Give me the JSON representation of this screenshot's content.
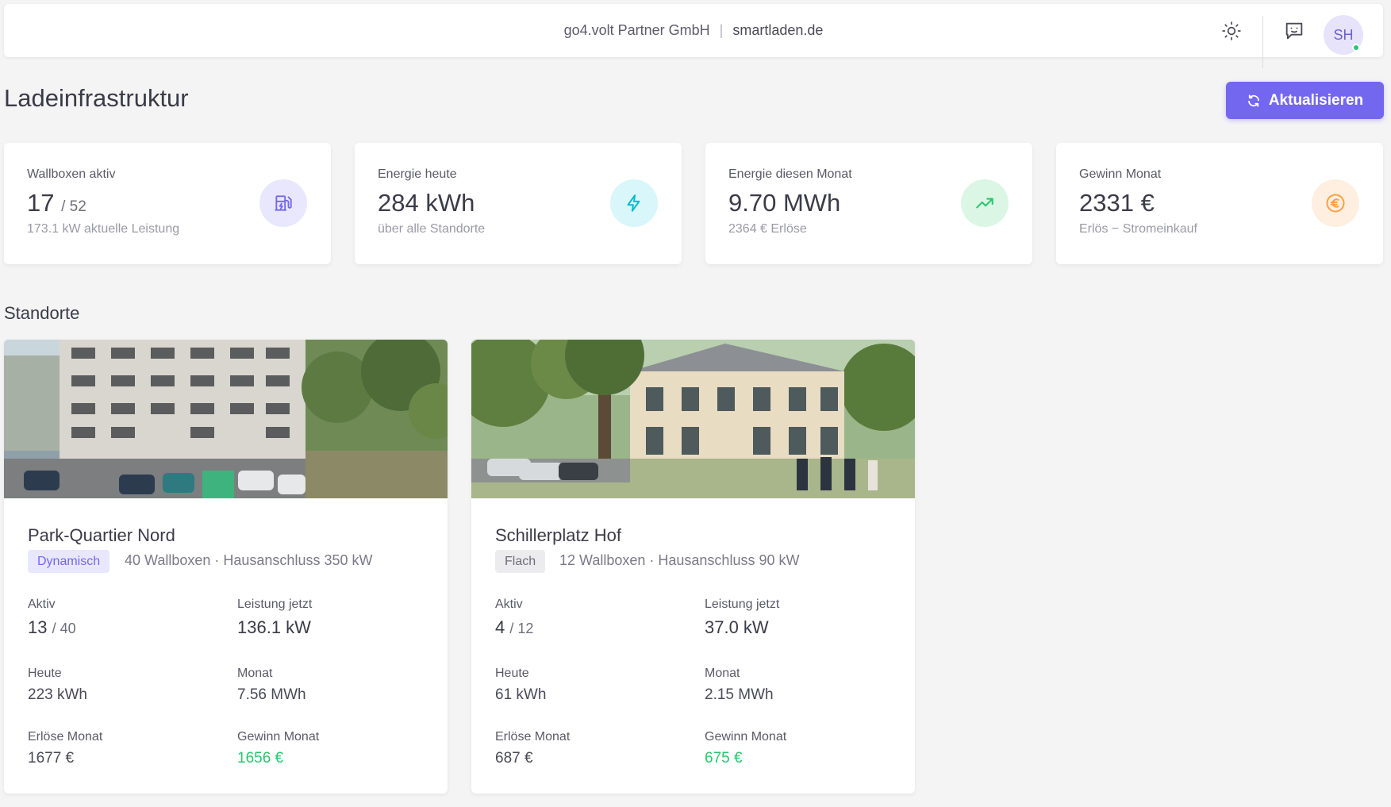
{
  "header": {
    "company": "go4.volt Partner GmbH",
    "separator": "|",
    "site": "smartladen.de",
    "theme_icon": "sun-icon",
    "chat_icon": "chat-icon",
    "avatar_initials": "SH",
    "avatar_status_color": "#28c76f"
  },
  "page": {
    "title": "Ladeinfrastruktur",
    "refresh_label": "Aktualisieren",
    "refresh_icon": "refresh-icon",
    "accent": "#7367f0"
  },
  "kpis": [
    {
      "label": "Wallboxen aktiv",
      "value": "17",
      "value_sub": "/ 52",
      "desc": "173.1 kW aktuelle Leistung",
      "icon": "ev-station-icon",
      "color": "#7367f0"
    },
    {
      "label": "Energie heute",
      "value": "284 kWh",
      "value_sub": "",
      "desc": "über alle Standorte",
      "icon": "lightning-icon",
      "color": "#00bad1"
    },
    {
      "label": "Energie diesen Monat",
      "value": "9.70 MWh",
      "value_sub": "",
      "desc": "2364 € Erlöse",
      "icon": "trending-up-icon",
      "color": "#28c76f"
    },
    {
      "label": "Gewinn Monat",
      "value": "2331 €",
      "value_sub": "",
      "desc": "Erlös − Stromeinkauf",
      "icon": "euro-icon",
      "color": "#ff9f43"
    }
  ],
  "section_title": "Standorte",
  "locations": [
    {
      "name": "Park-Quartier Nord",
      "tag": "Dynamisch",
      "meta": "40 Wallboxen · Hausanschluss 350 kW",
      "active_label": "Aktiv",
      "active_value": "13",
      "active_total": "/ 40",
      "power_label": "Leistung jetzt",
      "power_value": "136.1 kW",
      "today_label": "Heute",
      "today_value": "223 kWh",
      "month_label": "Monat",
      "month_value": "7.56 MWh",
      "revenue_label": "Erlöse Monat",
      "revenue_value": "1677 €",
      "profit_label": "Gewinn Monat",
      "profit_value": "1656 €"
    },
    {
      "name": "Schillerplatz Hof",
      "tag": "Flach",
      "meta": "12 Wallboxen · Hausanschluss 90 kW",
      "active_label": "Aktiv",
      "active_value": "4",
      "active_total": "/ 12",
      "power_label": "Leistung jetzt",
      "power_value": "37.0 kW",
      "today_label": "Heute",
      "today_value": "61 kWh",
      "month_label": "Monat",
      "month_value": "2.15 MWh",
      "revenue_label": "Erlöse Monat",
      "revenue_value": "687 €",
      "profit_label": "Gewinn Monat",
      "profit_value": "675 €"
    }
  ]
}
